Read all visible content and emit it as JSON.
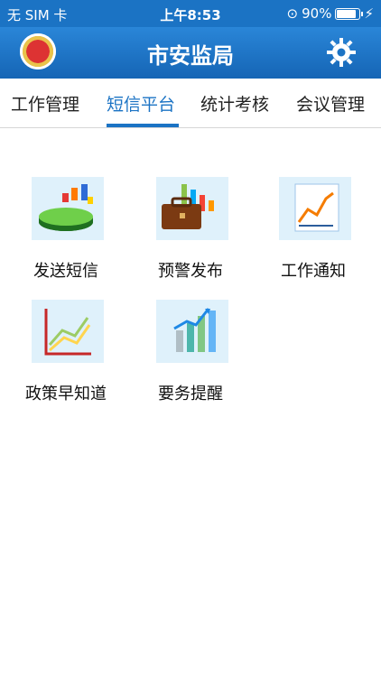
{
  "status_bar": {
    "carrier": "无 SIM 卡",
    "time": "上午8:53",
    "battery": "90%",
    "battery_level": 0.9
  },
  "nav": {
    "title": "市安监局",
    "emblem_icon": "emblem-icon",
    "settings_icon": "gear-icon"
  },
  "tabs": [
    {
      "label": "工作管理",
      "active": false
    },
    {
      "label": "短信平台",
      "active": true
    },
    {
      "label": "统计考核",
      "active": false
    },
    {
      "label": "会议管理",
      "active": false
    }
  ],
  "grid_items": [
    {
      "label": "发送短信",
      "icon": "pie-chart-icon"
    },
    {
      "label": "预警发布",
      "icon": "briefcase-chart-icon"
    },
    {
      "label": "工作通知",
      "icon": "line-graph-icon"
    },
    {
      "label": "政策早知道",
      "icon": "trend-lines-icon"
    },
    {
      "label": "要务提醒",
      "icon": "bar-chart-icon"
    }
  ],
  "colors": {
    "brand_blue": "#1b73c4",
    "white": "#ffffff",
    "text": "#111111"
  }
}
